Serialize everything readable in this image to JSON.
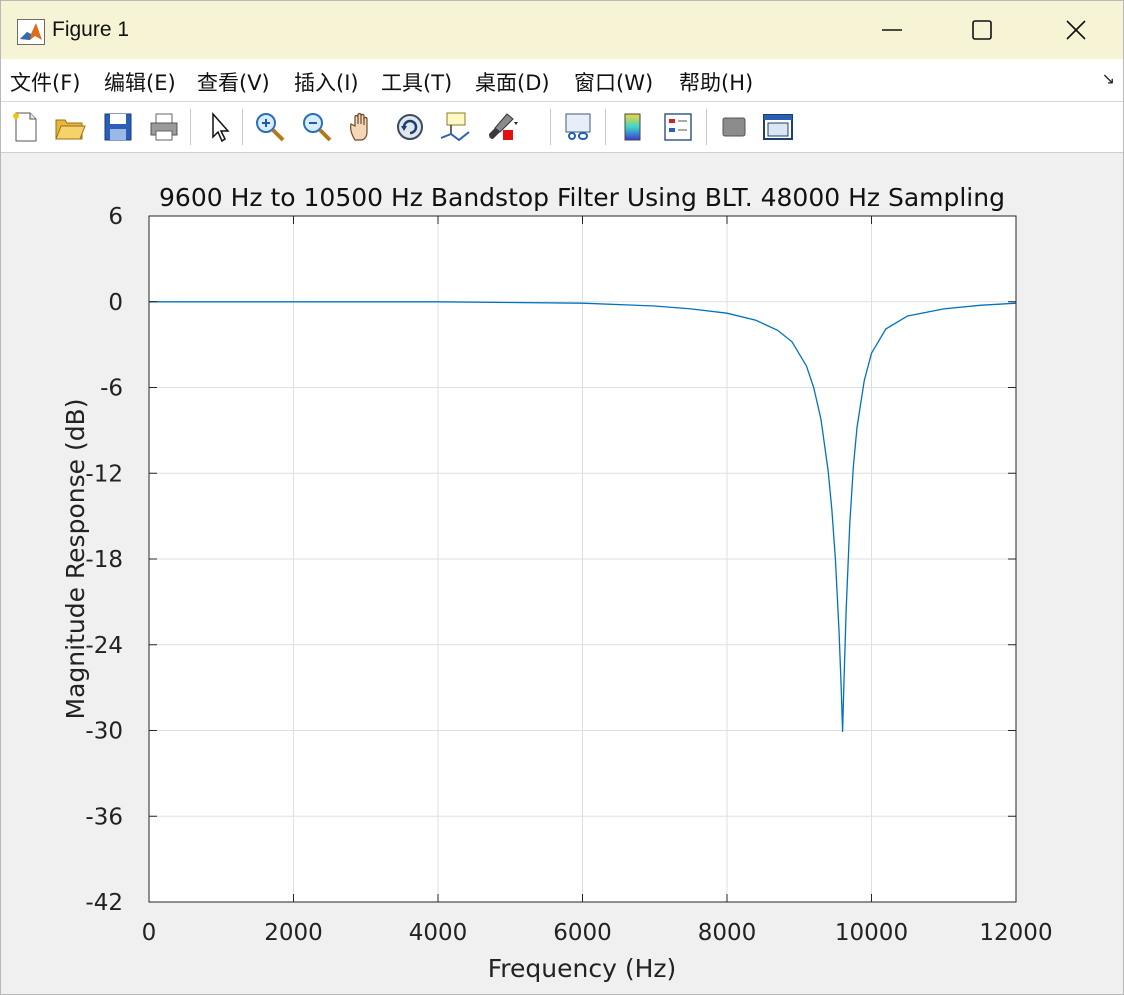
{
  "window": {
    "title": "Figure 1"
  },
  "menu": [
    {
      "label": "文件(F)",
      "key": "file"
    },
    {
      "label": "编辑(E)",
      "key": "edit"
    },
    {
      "label": "查看(V)",
      "key": "view"
    },
    {
      "label": "插入(I)",
      "key": "insert"
    },
    {
      "label": "工具(T)",
      "key": "tools"
    },
    {
      "label": "桌面(D)",
      "key": "desktop"
    },
    {
      "label": "窗口(W)",
      "key": "window"
    },
    {
      "label": "帮助(H)",
      "key": "help"
    }
  ],
  "toolbar": [
    "new-figure-icon",
    "open-file-icon",
    "save-icon",
    "print-icon",
    "pointer-icon",
    "zoom-in-icon",
    "zoom-out-icon",
    "pan-hand-icon",
    "rotate-3d-icon",
    "data-cursor-icon",
    "brush-icon",
    "link-plot-icon",
    "colorbar-icon",
    "legend-icon",
    "hide-plot-tools-icon",
    "show-plot-tools-icon"
  ],
  "colors": {
    "line": "#0072bd",
    "grid": "#dfdfdf",
    "axes": "#262626",
    "titlebar": "#f7f4d6"
  },
  "chart_data": {
    "type": "line",
    "title": "9600 Hz to 10500 Hz Bandstop Filter Using BLT. 48000 Hz Sampling",
    "xlabel": "Frequency (Hz)",
    "ylabel": "Magnitude Response (dB)",
    "xlim": [
      0,
      12000
    ],
    "ylim": [
      -42,
      6
    ],
    "xticks": [
      0,
      2000,
      4000,
      6000,
      8000,
      10000,
      12000
    ],
    "yticks": [
      6,
      0,
      -6,
      -12,
      -18,
      -24,
      -30,
      -36,
      -42
    ],
    "grid": true,
    "series": [
      {
        "x": [
          0,
          1000,
          2000,
          3000,
          4000,
          5000,
          6000,
          7000,
          7500,
          8000,
          8400,
          8700,
          8900,
          9100,
          9200,
          9300,
          9400,
          9450,
          9500,
          9550,
          9580,
          9600,
          9620,
          9650,
          9700,
          9750,
          9800,
          9900,
          10000,
          10200,
          10500,
          11000,
          11500,
          12000
        ],
        "y": [
          0,
          0,
          0,
          0,
          0,
          -0.05,
          -0.1,
          -0.3,
          -0.5,
          -0.8,
          -1.3,
          -2.0,
          -2.8,
          -4.5,
          -6.0,
          -8.2,
          -11.8,
          -14.5,
          -18.0,
          -23.0,
          -27.0,
          -30.1,
          -26.5,
          -21.5,
          -15.5,
          -11.5,
          -8.8,
          -5.5,
          -3.6,
          -1.9,
          -1.0,
          -0.5,
          -0.25,
          -0.1
        ]
      }
    ]
  }
}
